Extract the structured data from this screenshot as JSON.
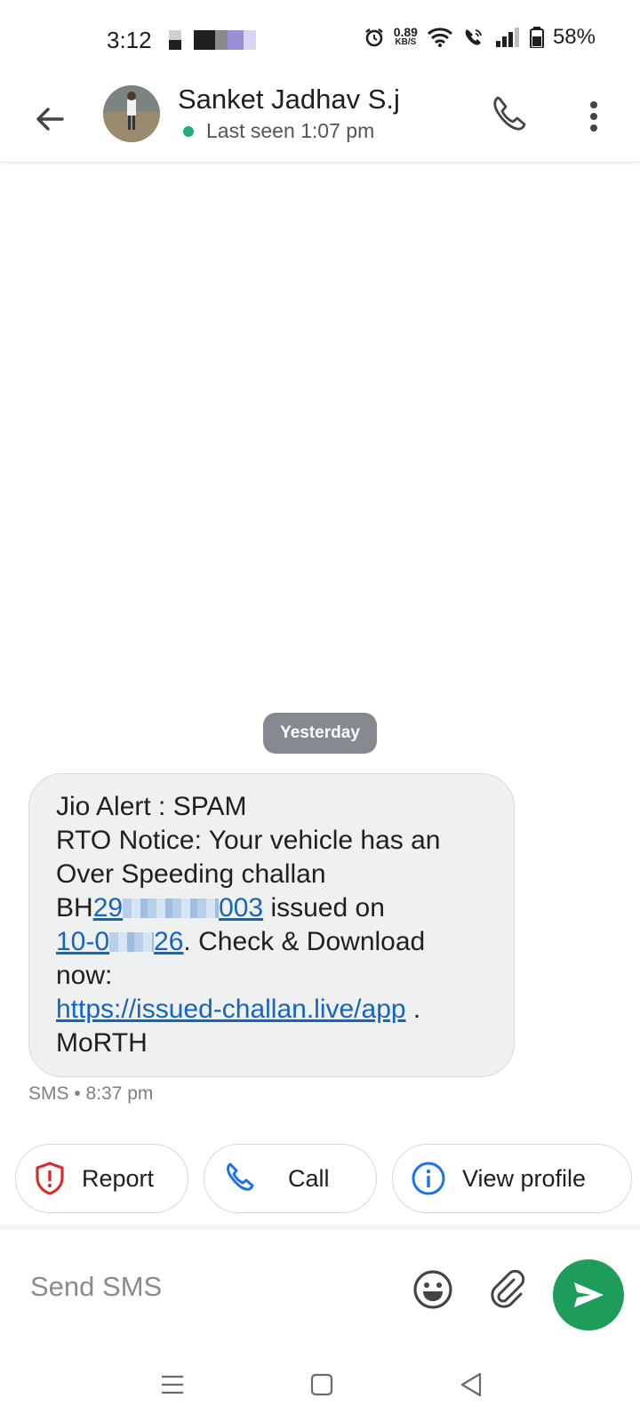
{
  "status_bar": {
    "time": "3:12",
    "net_speed_value": "0.89",
    "net_speed_unit": "KB/S",
    "battery": "58%"
  },
  "header": {
    "contact_name": "Sanket Jadhav S.j",
    "last_seen": "Last seen 1:07 pm"
  },
  "conversation": {
    "date_chip": "Yesterday",
    "message": {
      "line1": "Jio Alert : SPAM",
      "line2": "RTO Notice: Your vehicle has an",
      "line3": "Over Speeding challan",
      "challan_prefix": "BH",
      "challan_start": "29",
      "challan_end": "003",
      "issued_on": " issued on",
      "date_start": "10-0",
      "date_end": "26",
      "after_date": ". Check & Download",
      "now": "now:",
      "url": "https://issued-challan.live/app",
      "url_suffix": " .",
      "signature": "MoRTH"
    },
    "meta": "SMS • 8:37 pm"
  },
  "actions": {
    "report": "Report",
    "call": "Call",
    "view_profile": "View profile"
  },
  "composer": {
    "placeholder": "Send SMS"
  },
  "colors": {
    "send_button": "#1e9c59",
    "link": "#1565c0",
    "report_icon": "#d32f2f",
    "action_icon_blue": "#1a73e8",
    "online_dot": "#1fae77"
  }
}
